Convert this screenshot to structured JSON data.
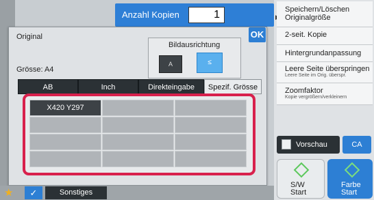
{
  "top": {
    "copies_label": "Anzahl Kopien",
    "copies_value": "1"
  },
  "dialog": {
    "title": "Original",
    "ok_label": "OK",
    "orientation_label": "Bildausrichtung",
    "orientation_a": "A",
    "orientation_b": "≤",
    "size_label": "Grösse: A4",
    "tabs": [
      "AB",
      "Inch",
      "Direkteingabe",
      "Spezif. Grösse"
    ],
    "active_tab": "Spezif. Grösse",
    "custom_sizes": [
      "X420 Y297"
    ]
  },
  "menu": [
    {
      "main": "Speichern/Löschen Originalgröße",
      "sub": ""
    },
    {
      "main": "2-seit. Kopie",
      "sub": ""
    },
    {
      "main": "Hintergrundanpassung",
      "sub": ""
    },
    {
      "main": "Leere Seite überspringen",
      "sub": "Leere Seite im Orig. überspr."
    },
    {
      "main": "Zoomfaktor",
      "sub": "Kopie vergrößern/verkleinern"
    }
  ],
  "buttons": {
    "preview": "Vorschau",
    "ca": "CA",
    "bw_line1": "S/W",
    "bw_line2": "Start",
    "color_line1": "Farbe",
    "color_line2": "Start",
    "sonstiges": "Sonstiges"
  },
  "colors": {
    "accent": "#2d7fd4",
    "highlight_frame": "#d8204c",
    "start_green": "#5cc85c"
  },
  "icons": [
    "star-icon",
    "check-icon",
    "preview-icon",
    "start-icon",
    "arrow-right-icon"
  ]
}
